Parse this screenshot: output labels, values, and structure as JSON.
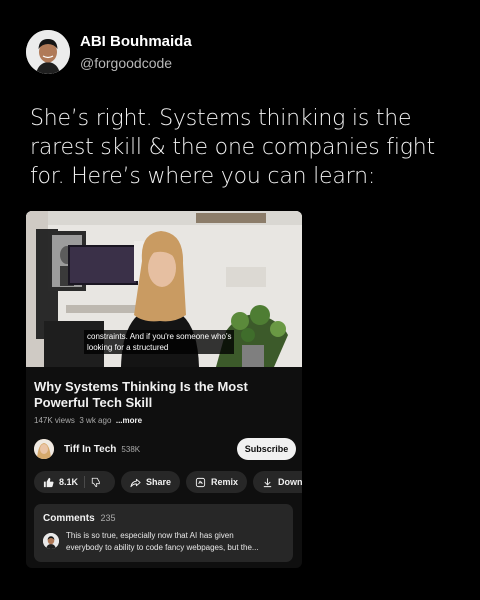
{
  "post": {
    "author_name": "ABI Bouhmaida",
    "author_handle": "@forgoodcode",
    "text_lines": [
      "She’s right. Systems thinking is the",
      "rarest skill & the one companies fight",
      "for. Here’s where you can learn:"
    ]
  },
  "video": {
    "captions": [
      "constraints. And if you're someone who's",
      "looking for a structured"
    ],
    "title_lines": [
      "Why Systems Thinking Is the Most",
      "Powerful Tech Skill"
    ],
    "views": "147K views",
    "age": "3 wk ago",
    "more_label": "...more"
  },
  "channel": {
    "name": "Tiff In Tech",
    "subscribers": "538K",
    "subscribe_label": "Subscribe"
  },
  "actions": {
    "like_count": "8.1K",
    "share_label": "Share",
    "remix_label": "Remix",
    "download_label": "Download"
  },
  "comments": {
    "label": "Comments",
    "count": "235",
    "top_comment_lines": [
      "This is so true, especially now that AI has given",
      "everybody to ability to code fancy webpages, but the..."
    ]
  },
  "colors": {
    "background": "#000000",
    "card": "#0f0f0f",
    "pill": "#272727",
    "subscribe_bg": "#f1f1f1"
  },
  "icons": [
    "thumbs-up-icon",
    "thumbs-down-icon",
    "share-icon",
    "remix-icon",
    "download-icon"
  ]
}
